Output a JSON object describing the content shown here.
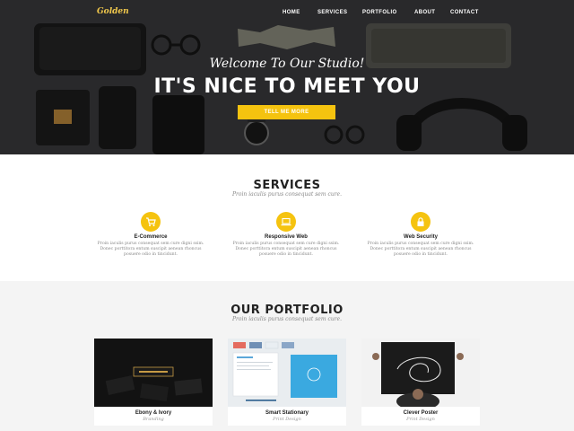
{
  "brand": {
    "logo": "Golden",
    "accent": "#f5c30f"
  },
  "nav": {
    "items": [
      {
        "label": "HOME"
      },
      {
        "label": "SERVICES"
      },
      {
        "label": "PORTFOLIO"
      },
      {
        "label": "ABOUT"
      },
      {
        "label": "CONTACT"
      }
    ]
  },
  "hero": {
    "subtitle": "Welcome To Our Studio!",
    "title": "IT'S NICE TO MEET YOU",
    "button": "TELL ME MORE"
  },
  "services": {
    "title": "SERVICES",
    "subtitle": "Proin iaculis purus consequat sem cure.",
    "items": [
      {
        "name": "E-Commerce",
        "icon": "cart-icon",
        "text": "Proin iaculis purus consequat sem cure digni ssim. Donec porttitora entum suscipit aenean rhoncus posuere odio in tincidunt."
      },
      {
        "name": "Responsive Web",
        "icon": "laptop-icon",
        "text": "Proin iaculis purus consequat sem cure digni ssim. Donec porttitora entum suscipit aenean rhoncus posuere odio in tincidunt."
      },
      {
        "name": "Web Security",
        "icon": "lock-icon",
        "text": "Proin iaculis purus consequat sem cure digni ssim. Donec porttitora entum suscipit aenean rhoncus posuere odio in tincidunt."
      }
    ]
  },
  "portfolio": {
    "title": "OUR PORTFOLIO",
    "subtitle": "Proin iaculis purus consequat sem cure.",
    "items": [
      {
        "name": "Ebony & Ivory",
        "category": "Branding"
      },
      {
        "name": "Smart Stationary",
        "category": "Print Design"
      },
      {
        "name": "Clever Poster",
        "category": "Print Design"
      }
    ]
  }
}
